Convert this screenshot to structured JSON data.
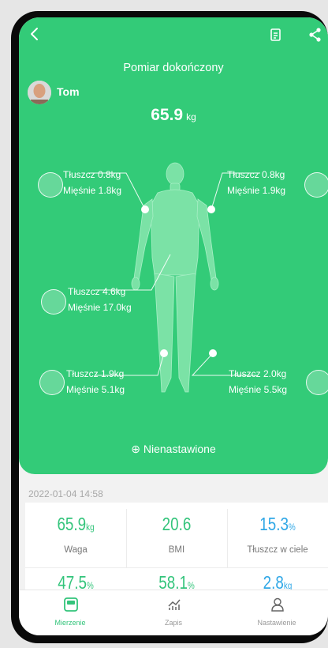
{
  "header": {
    "title": "Pomiar dokończony",
    "user_name": "Tom",
    "weight_value": "65.9",
    "weight_unit": "kg"
  },
  "segments": {
    "left_arm": {
      "fat": "Tłuszcz 0.8kg",
      "muscle": "Mięśnie 1.8kg"
    },
    "right_arm": {
      "fat": "Tłuszcz 0.8kg",
      "muscle": "Mięśnie 1.9kg"
    },
    "trunk": {
      "fat": "Tłuszcz 4.6kg",
      "muscle": "Mięśnie 17.0kg"
    },
    "left_leg": {
      "fat": "Tłuszcz 1.9kg",
      "muscle": "Mięśnie 5.1kg"
    },
    "right_leg": {
      "fat": "Tłuszcz 2.0kg",
      "muscle": "Mięśnie 5.5kg"
    }
  },
  "status": "Nienastawione",
  "timestamp": "2022-01-04 14:58",
  "metrics": [
    {
      "value": "65.9",
      "unit": "kg",
      "label": "Waga"
    },
    {
      "value": "20.6",
      "unit": "",
      "label": "BMI"
    },
    {
      "value": "15.3",
      "unit": "%",
      "label": "Tłuszcz w ciele"
    },
    {
      "value": "47.5",
      "unit": "%",
      "label": ""
    },
    {
      "value": "58.1",
      "unit": "%",
      "label": ""
    },
    {
      "value": "2.8",
      "unit": "kg",
      "label": ""
    }
  ],
  "tabs": [
    {
      "label": "Mierzenie",
      "icon": "scale-icon",
      "active": true
    },
    {
      "label": "Zapis",
      "icon": "chart-icon",
      "active": false
    },
    {
      "label": "Nastawienie",
      "icon": "person-icon",
      "active": false
    }
  ],
  "colors": {
    "accent": "#33cb78",
    "value_green": "#33c47b",
    "value_blue": "#2fa7e6"
  }
}
